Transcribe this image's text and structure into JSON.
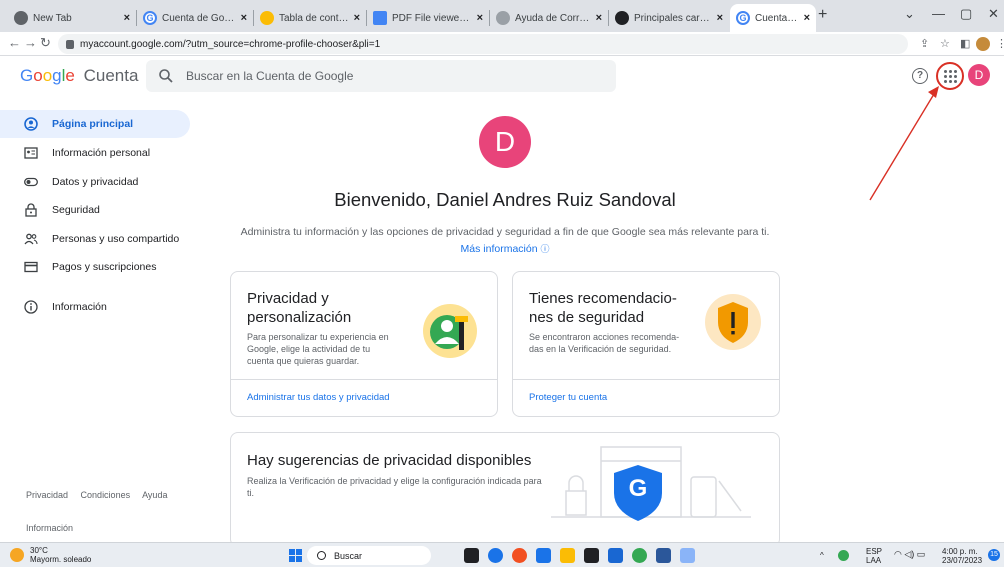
{
  "browser": {
    "tabs": [
      {
        "label": "New Tab",
        "favicon_color": "#5f6368",
        "active": false
      },
      {
        "label": "Cuenta de Google",
        "favicon_color": "#4285f4",
        "active": false
      },
      {
        "label": "Tabla de contenido - ",
        "favicon_color": "#fbbc05",
        "active": false
      },
      {
        "label": "PDF File viewer | Micr",
        "favicon_color": "#4285f4",
        "active": false
      },
      {
        "label": "Ayuda de Corrección.",
        "favicon_color": "#9aa0a6",
        "active": false
      },
      {
        "label": "Principales caracterís",
        "favicon_color": "#202124",
        "active": false
      },
      {
        "label": "Cuenta de Google",
        "favicon_color": "#4285f4",
        "active": true
      }
    ],
    "url": "myaccount.google.com/?utm_source=chrome-profile-chooser&pli=1"
  },
  "header": {
    "logo_letters": [
      "G",
      "o",
      "o",
      "g",
      "l",
      "e"
    ],
    "product": "Cuenta",
    "search_placeholder": "Buscar en la Cuenta de Google",
    "help_glyph": "?",
    "avatar_letter": "D"
  },
  "sidebar": {
    "items": [
      {
        "label": "Página principal",
        "icon": "home-icon",
        "active": true
      },
      {
        "label": "Información personal",
        "icon": "id-card-icon",
        "active": false
      },
      {
        "label": "Datos y privacidad",
        "icon": "toggle-icon",
        "active": false
      },
      {
        "label": "Seguridad",
        "icon": "lock-icon",
        "active": false
      },
      {
        "label": "Personas y uso compartido",
        "icon": "people-icon",
        "active": false
      },
      {
        "label": "Pagos y suscripciones",
        "icon": "card-icon",
        "active": false
      },
      {
        "label": "Información",
        "icon": "info-icon",
        "active": false
      }
    ],
    "footer": {
      "privacy": "Privacidad",
      "terms": "Condiciones",
      "help": "Ayuda",
      "info": "Información"
    }
  },
  "main": {
    "avatar_letter": "D",
    "welcome": "Bienvenido, Daniel Andres Ruiz Sandoval",
    "subtitle": "Administra tu información y las opciones de privacidad y seguridad a fin de que Google sea más relevante para ti.",
    "more_info": "Más información",
    "cards": {
      "privacy": {
        "title": "Privacidad y personalización",
        "body": "Para personalizar tu experiencia en Google, elige la actividad de tu cuenta que quieras guardar.",
        "link": "Administrar tus datos y privacidad"
      },
      "security": {
        "title": "Tienes recomendacio-nes de seguridad",
        "body": "Se encontraron acciones recomenda-das en la Verificación de seguridad.",
        "link": "Proteger tu cuenta"
      },
      "suggestions": {
        "title": "Hay sugerencias de privacidad disponibles",
        "body": "Realiza la Verificación de privacidad y elige la configuración indicada para ti.",
        "shield_letter": "G"
      }
    }
  },
  "taskbar": {
    "temp": "30°C",
    "weather": "Mayorm. soleado",
    "search": "Buscar",
    "lang1": "ESP",
    "lang2": "LAA",
    "time": "4:00 p. m.",
    "date": "23/07/2023",
    "badge": "15"
  },
  "colors": {
    "accent": "#1a73e8",
    "avatar": "#e8447a",
    "annotation": "#d93025"
  }
}
